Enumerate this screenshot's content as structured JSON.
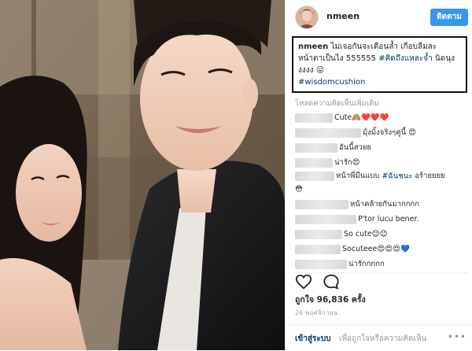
{
  "post": {
    "username": "nmeen",
    "follow_label": "ติดตาม",
    "caption_user": "nmeen",
    "caption_text": "ไม่เจอกันจะเดือนล้ำ เกือบลืมละหน้าตาเป็นไง 555555",
    "caption_tag1": "#คิดถึงแหละจ้ำ",
    "caption_tail": "นิดนุงงงงง 😛",
    "caption_tag2": "#wisdomcushion",
    "load_more": "โหลดความคิดเห็นเพิ่มเติม",
    "comments": [
      {
        "text": "Cute🙈❤️❤️❤️",
        "blur_w": 48
      },
      {
        "text": "มุ้งมิ้งจริงๆคู่นี้ 😍",
        "blur_w": 84
      },
      {
        "text": "อันนี้สวยย",
        "blur_w": 54
      },
      {
        "text": "น่ารัก😍",
        "blur_w": 48
      },
      {
        "text": "หน้าพี่มีนแบบ",
        "mention": "#ฉันชนะ",
        "tail": "อร้ายยยย",
        "second": "😳",
        "blur_w": 50
      },
      {
        "text": "หน้าคล้ายกันมากกกก",
        "blur_w": 68
      },
      {
        "text": "P'tor lucu bener.",
        "blur_w": 78
      },
      {
        "text": "So cute😊😊",
        "blur_w": 60
      },
      {
        "text": "Socuteee😍😍😍💙",
        "blur_w": 58
      },
      {
        "text": "น่ารักกกกก",
        "blur_w": 66
      }
    ],
    "likes_prefix": "ถูกใจ",
    "likes_value": "96,836",
    "likes_suffix": "ครั้ง",
    "date": "26 พฤศจิกายน",
    "login_link": "เข้าสู่ระบบ",
    "login_rest": "เพื่อถูกใจหรือความคิดเห็น",
    "more_dots": "•••"
  },
  "colors": {
    "follow_blue": "#3897f0",
    "link_blue": "#003569",
    "muted": "#999999"
  },
  "icons": [
    "heart-icon",
    "comment-icon",
    "more-icon"
  ]
}
